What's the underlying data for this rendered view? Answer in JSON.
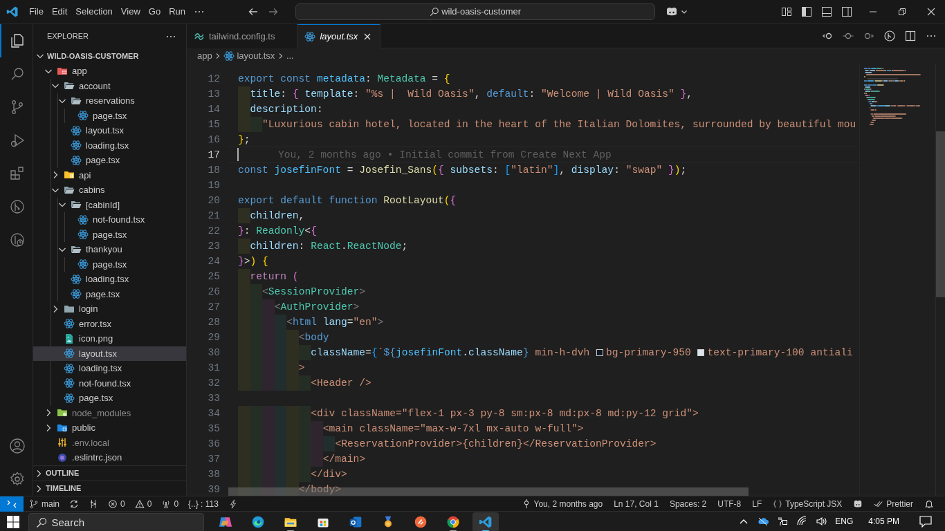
{
  "titlebar": {
    "menu": [
      "File",
      "Edit",
      "Selection",
      "View",
      "Go",
      "Run"
    ],
    "search": "wild-oasis-customer"
  },
  "activity_bar": [
    {
      "selected": true
    },
    {
      "selected": false
    },
    {
      "selected": false
    },
    {
      "selected": false
    },
    {
      "selected": false
    },
    {
      "selected": false
    },
    {
      "selected": false
    }
  ],
  "explorer": {
    "title": "EXPLORER",
    "root": {
      "label": "WILD-OASIS-CUSTOMER",
      "expanded": true
    },
    "tree": [
      {
        "label": "app",
        "kind": "appfolder",
        "expanded": true,
        "selected": false,
        "dimmed": false,
        "children": [
          {
            "label": "account",
            "kind": "folder",
            "expanded": true,
            "selected": false,
            "children": [
              {
                "label": "reservations",
                "kind": "folder",
                "expanded": true,
                "selected": false,
                "children": [
                  {
                    "label": "page.tsx",
                    "kind": "component",
                    "selected": false
                  }
                ]
              },
              {
                "label": "layout.tsx",
                "kind": "component",
                "selected": false
              },
              {
                "label": "loading.tsx",
                "kind": "component",
                "selected": false
              },
              {
                "label": "page.tsx",
                "kind": "component",
                "selected": false
              }
            ]
          },
          {
            "label": "api",
            "kind": "apifolder",
            "expanded": false,
            "selected": false
          },
          {
            "label": "cabins",
            "kind": "folder",
            "expanded": true,
            "selected": false,
            "children": [
              {
                "label": "[cabinId]",
                "kind": "folder",
                "expanded": true,
                "selected": false,
                "children": [
                  {
                    "label": "not-found.tsx",
                    "kind": "component",
                    "selected": false
                  },
                  {
                    "label": "page.tsx",
                    "kind": "component",
                    "selected": false
                  }
                ]
              },
              {
                "label": "thankyou",
                "kind": "folder",
                "expanded": true,
                "selected": false,
                "children": [
                  {
                    "label": "page.tsx",
                    "kind": "component",
                    "selected": false
                  }
                ]
              },
              {
                "label": "loading.tsx",
                "kind": "component",
                "selected": false
              },
              {
                "label": "page.tsx",
                "kind": "component",
                "selected": false
              }
            ]
          },
          {
            "label": "login",
            "kind": "folder",
            "expanded": false,
            "selected": false
          },
          {
            "label": "error.tsx",
            "kind": "component",
            "selected": false
          },
          {
            "label": "icon.png",
            "kind": "image",
            "selected": false
          },
          {
            "label": "layout.tsx",
            "kind": "component",
            "selected": true
          },
          {
            "label": "loading.tsx",
            "kind": "component",
            "selected": false
          },
          {
            "label": "not-found.tsx",
            "kind": "component",
            "selected": false
          },
          {
            "label": "page.tsx",
            "kind": "component",
            "selected": false
          }
        ]
      },
      {
        "label": "node_modules",
        "kind": "modulesfolder",
        "expanded": false,
        "selected": false,
        "dimmed": true
      },
      {
        "label": "public",
        "kind": "publicfolder",
        "expanded": false,
        "selected": false,
        "dimmed": false
      },
      {
        "label": ".env.local",
        "kind": "env",
        "selected": false,
        "dimmed": true
      },
      {
        "label": ".eslintrc.json",
        "kind": "config",
        "selected": false,
        "dimmed": false
      }
    ],
    "sections": [
      {
        "label": "OUTLINE",
        "expanded": false
      },
      {
        "label": "TIMELINE",
        "expanded": false
      }
    ]
  },
  "tabs": [
    {
      "label": "tailwind.config.ts",
      "kind": "style",
      "selected": false,
      "preview": false
    },
    {
      "label": "layout.tsx",
      "kind": "component",
      "selected": true,
      "preview": true
    }
  ],
  "breadcrumbs": [
    {
      "label": "app",
      "kind": "folder"
    },
    {
      "label": "layout.tsx",
      "kind": "component"
    },
    {
      "label": "...",
      "kind": "more"
    }
  ],
  "editor": {
    "lines": [
      {
        "n": "12",
        "current": false,
        "text": "export const metadata: Metadata = {"
      },
      {
        "n": "13",
        "current": false,
        "text": "  title: { template: \"%s |  Wild Oasis\", default: \"Welcome | Wild Oasis\" },"
      },
      {
        "n": "14",
        "current": false,
        "text": "  description:"
      },
      {
        "n": "15",
        "current": false,
        "text": "    \"Luxurious cabin hotel, located in the heart of the Italian Dolomites, surrounded by beautiful mou"
      },
      {
        "n": "16",
        "current": false,
        "text": "};"
      },
      {
        "n": "17",
        "current": true,
        "blame": "You, 2 months ago • Initial commit from Create Next App"
      },
      {
        "n": "18",
        "current": false,
        "text": "const josefinFont = Josefin_Sans({ subsets: [\"latin\"], display: \"swap\" });"
      },
      {
        "n": "19",
        "current": false
      },
      {
        "n": "20",
        "current": false,
        "text": "export default function RootLayout({"
      },
      {
        "n": "21",
        "current": false,
        "text": "  children,"
      },
      {
        "n": "22",
        "current": false,
        "text": "}: Readonly<{"
      },
      {
        "n": "23",
        "current": false,
        "text": "  children: React.ReactNode;"
      },
      {
        "n": "24",
        "current": false,
        "text": "}>) {"
      },
      {
        "n": "25",
        "current": false,
        "text": "  return ("
      },
      {
        "n": "26",
        "current": false,
        "text": "    <SessionProvider>"
      },
      {
        "n": "27",
        "current": false,
        "text": "      <AuthProvider>"
      },
      {
        "n": "28",
        "current": false,
        "text": "        <html lang=\"en\">"
      },
      {
        "n": "29",
        "current": false,
        "text": "          <body"
      },
      {
        "n": "30",
        "current": false,
        "segments": [
          {
            "text": "            className={`${josefinFont.className} min-h-dvh "
          },
          {
            "color": "#101823",
            "text": "bg-primary-950 "
          },
          {
            "color": "#dce4ec",
            "text": "text-primary-100 antiali"
          }
        ]
      },
      {
        "n": "31",
        "current": false,
        "text": "          >"
      },
      {
        "n": "32",
        "current": false,
        "text": "            <Header />"
      },
      {
        "n": "33",
        "current": false
      },
      {
        "n": "34",
        "current": false,
        "text": "            <div className=\"flex-1 px-3 py-8 sm:px-8 md:px-8 md:py-12 grid\">"
      },
      {
        "n": "35",
        "current": false,
        "text": "              <main className=\"max-w-7xl mx-auto w-full\">"
      },
      {
        "n": "36",
        "current": false,
        "text": "                <ReservationProvider>{children}</ReservationProvider>"
      },
      {
        "n": "37",
        "current": false,
        "text": "              </main>"
      },
      {
        "n": "38",
        "current": false,
        "text": "            </div>"
      },
      {
        "n": "39",
        "current": false,
        "text": "          </body>"
      }
    ]
  },
  "status_left": [
    {
      "kind": "branch",
      "text": "main"
    },
    {
      "kind": "sync"
    },
    {
      "kind": "graph"
    },
    {
      "kind": "error",
      "text": "0"
    },
    {
      "kind": "warning",
      "text": "0"
    },
    {
      "kind": "ports",
      "text": "0"
    },
    {
      "kind": "text",
      "text": "{..} : 113"
    },
    {
      "kind": "bolt"
    }
  ],
  "status_right": [
    {
      "kind": "commit",
      "text": "You, 2 months ago"
    },
    {
      "kind": "text",
      "text": "Ln 17, Col 1"
    },
    {
      "kind": "text",
      "text": "Spaces: 2"
    },
    {
      "kind": "text",
      "text": "UTF-8"
    },
    {
      "kind": "text",
      "text": "LF"
    },
    {
      "kind": "braces",
      "text": "TypeScript JSX"
    },
    {
      "kind": "robot"
    },
    {
      "kind": "checks",
      "text": "Prettier"
    },
    {
      "kind": "bell"
    }
  ],
  "taskbar": {
    "search": "Search",
    "apps": [
      {
        "kind": "ribbon",
        "running": false,
        "selected": false
      },
      {
        "kind": "swirl",
        "running": false,
        "selected": false
      },
      {
        "kind": "folder",
        "running": true,
        "selected": false
      },
      {
        "kind": "store",
        "running": false,
        "selected": false
      },
      {
        "kind": "mail",
        "running": false,
        "selected": false
      },
      {
        "kind": "medal",
        "running": false,
        "selected": false
      },
      {
        "kind": "slash",
        "running": false,
        "selected": false
      },
      {
        "kind": "browser",
        "running": true,
        "selected": false
      },
      {
        "kind": "editor",
        "running": true,
        "selected": true
      }
    ],
    "tray": {
      "language": "ENG",
      "time": "4:05 PM"
    }
  }
}
